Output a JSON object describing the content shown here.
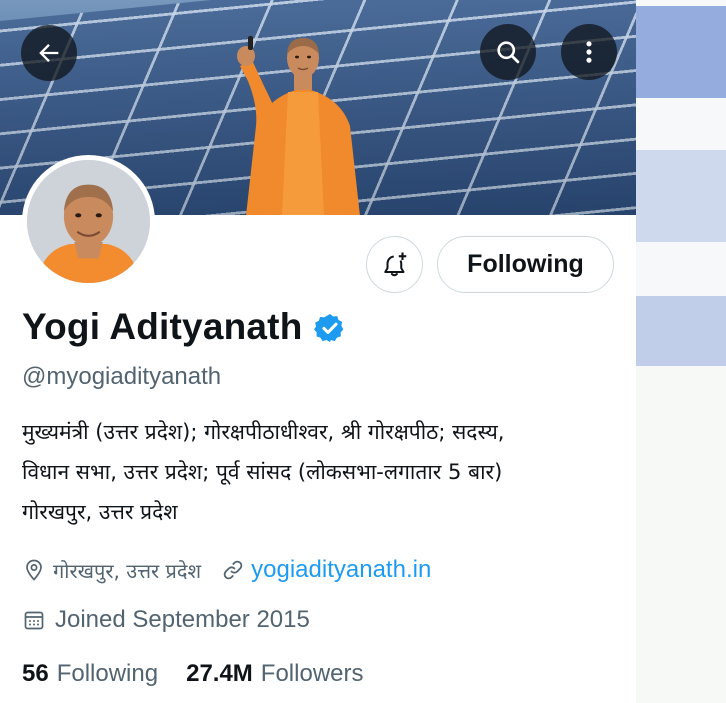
{
  "header": {
    "back_icon": "arrow-left-icon",
    "search_icon": "search-icon",
    "more_icon": "more-vertical-icon"
  },
  "profile": {
    "display_name": "Yogi Adityanath",
    "verified": true,
    "verified_color": "#1d9bf0",
    "handle": "@myogiadityanath",
    "bio_lines": [
      "मुख्यमंत्री (उत्तर प्रदेश); गोरक्षपीठाधीश्वर, श्री गोरक्षपीठ; सदस्य,",
      "विधान सभा, उत्तर प्रदेश; पूर्व सांसद (लोकसभा-लगातार 5 बार)",
      "गोरखपुर, उत्तर प्रदेश"
    ],
    "location": "गोरखपुर, उत्तर प्रदेश",
    "website": "yogiadityanath.in",
    "joined": "Joined September 2015"
  },
  "actions": {
    "notify_icon": "bell-plus-icon",
    "following_label": "Following"
  },
  "stats": {
    "following_count": "56",
    "following_label": "Following",
    "followers_count": "27.4M",
    "followers_label": "Followers"
  },
  "colors": {
    "text_primary": "#0f1419",
    "text_secondary": "#536471",
    "link": "#1d9bf0",
    "border": "#cfd9de"
  }
}
